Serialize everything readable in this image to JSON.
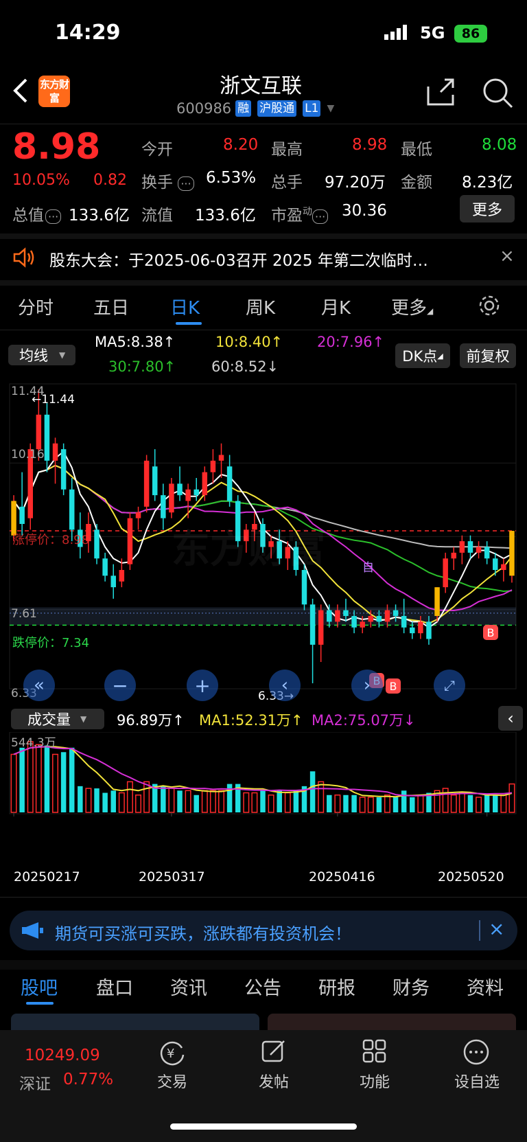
{
  "status_bar": {
    "time": "14:29",
    "network": "5G",
    "battery": "86"
  },
  "header": {
    "logo": "东方财富",
    "title": "浙文互联",
    "code": "600986",
    "tags": [
      "融",
      "沪股通",
      "L1"
    ]
  },
  "quote": {
    "price": "8.98",
    "change_pct": "10.05%",
    "change": "0.82",
    "open_label": "今开",
    "open": "8.20",
    "high_label": "最高",
    "high": "8.98",
    "low_label": "最低",
    "low": "8.08",
    "turnover_label": "换手",
    "turnover": "6.53%",
    "volume_label": "总手",
    "volume": "97.20万",
    "amount_label": "金额",
    "amount": "8.23亿",
    "mcap_label": "总值",
    "mcap": "133.6亿",
    "float_label": "流值",
    "float": "133.6亿",
    "pe_label": "市盈",
    "pe_sup": "动",
    "pe": "30.36",
    "more": "更多"
  },
  "notice": {
    "text": "股东大会：于2025-06-03召开 2025 年第二次临时…"
  },
  "period_tabs": [
    "分时",
    "五日",
    "日K",
    "周K",
    "月K",
    "更多"
  ],
  "period_active": 2,
  "ma_bar": {
    "selector": "均线",
    "ma5": "MA5:8.38↑",
    "ma10": "10:8.40↑",
    "ma20": "20:7.96↑",
    "ma30": "30:7.80↑",
    "ma60": "60:8.52↓",
    "dk": "DK点",
    "adjust": "前复权"
  },
  "kline": {
    "y_top": "11.44",
    "y_high2": "10.16",
    "y_88": "8.88",
    "y_761": "7.61",
    "y_bottom": "6.33",
    "max_label": "←11.44",
    "min_label": "6.33→",
    "limit_up_label": "涨停价：8.98",
    "limit_down_label": "跌停价：7.34",
    "watermark": "东方财富",
    "mark_zi": "自",
    "mark_b": "B",
    "limit_up": 8.98,
    "limit_down": 7.34,
    "ymin": 6.33,
    "ymax": 11.44
  },
  "volume_bar": {
    "selector": "成交量",
    "vol": "96.89万↑",
    "ma1": "MA1:52.31万↑",
    "ma2": "MA2:75.07万↓",
    "y_top": "544.3万"
  },
  "dates": [
    "20250217",
    "20250317",
    "20250416",
    "20250520"
  ],
  "banner": {
    "text": "期货可买涨可买跌，涨跌都有投资机会！"
  },
  "bottom_tabs": [
    "股吧",
    "盘口",
    "资讯",
    "公告",
    "研报",
    "财务",
    "资料"
  ],
  "bottom_active": 0,
  "bottom_nav": {
    "index_value": "10249.09",
    "index_name": "深证",
    "index_pct": "0.77%",
    "items": [
      "交易",
      "发帖",
      "功能",
      "设自选"
    ]
  },
  "colors": {
    "up": "#ff2a2a",
    "down": "#1fdfe0",
    "ma5": "#ffffff",
    "ma10": "#f2e33a",
    "ma20": "#d52fd5",
    "ma30": "#2bbf2b",
    "ma60": "#bdbdbd",
    "accent": "#2d8cf0"
  },
  "chart_data": {
    "type": "candlestick",
    "x_ticks": [
      "20250217",
      "20250317",
      "20250416",
      "20250520"
    ],
    "ylim": [
      6.33,
      11.44
    ],
    "candles": [
      [
        8.9,
        9.6,
        8.8,
        9.5
      ],
      [
        9.4,
        10.0,
        8.9,
        9.1
      ],
      [
        9.2,
        10.5,
        9.0,
        10.4
      ],
      [
        10.4,
        11.44,
        10.2,
        11.0
      ],
      [
        11.0,
        11.2,
        10.0,
        10.2
      ],
      [
        10.2,
        10.6,
        9.8,
        10.5
      ],
      [
        10.4,
        10.5,
        9.6,
        9.7
      ],
      [
        9.7,
        9.9,
        8.8,
        9.0
      ],
      [
        9.0,
        9.3,
        8.5,
        8.7
      ],
      [
        8.8,
        9.3,
        8.6,
        9.1
      ],
      [
        9.0,
        9.1,
        8.4,
        8.5
      ],
      [
        8.5,
        8.6,
        8.1,
        8.2
      ],
      [
        8.2,
        8.4,
        7.8,
        8.0
      ],
      [
        8.1,
        8.5,
        8.0,
        8.3
      ],
      [
        8.4,
        9.3,
        8.3,
        9.2
      ],
      [
        9.2,
        9.4,
        9.0,
        9.3
      ],
      [
        9.4,
        10.3,
        9.3,
        10.2
      ],
      [
        10.1,
        10.4,
        9.5,
        9.6
      ],
      [
        9.6,
        9.8,
        9.0,
        9.2
      ],
      [
        9.3,
        9.9,
        9.2,
        9.8
      ],
      [
        9.8,
        10.1,
        9.5,
        9.6
      ],
      [
        9.5,
        9.8,
        9.2,
        9.7
      ],
      [
        9.7,
        9.9,
        9.5,
        9.6
      ],
      [
        9.6,
        10.1,
        9.5,
        10.0
      ],
      [
        10.0,
        10.4,
        9.8,
        10.2
      ],
      [
        10.2,
        10.5,
        9.9,
        10.3
      ],
      [
        10.1,
        10.3,
        9.4,
        9.5
      ],
      [
        9.5,
        9.6,
        8.7,
        8.8
      ],
      [
        8.8,
        9.1,
        8.6,
        9.0
      ],
      [
        9.0,
        9.3,
        8.8,
        9.1
      ],
      [
        9.1,
        9.2,
        8.6,
        8.7
      ],
      [
        8.7,
        8.9,
        8.5,
        8.8
      ],
      [
        8.8,
        9.0,
        8.4,
        8.5
      ],
      [
        8.5,
        8.8,
        8.3,
        8.7
      ],
      [
        8.7,
        8.8,
        8.2,
        8.3
      ],
      [
        8.3,
        8.4,
        7.6,
        7.7
      ],
      [
        7.7,
        7.8,
        6.33,
        7.0
      ],
      [
        7.0,
        7.7,
        6.7,
        7.6
      ],
      [
        7.6,
        7.7,
        7.3,
        7.4
      ],
      [
        7.4,
        7.7,
        7.3,
        7.6
      ],
      [
        7.6,
        7.8,
        7.4,
        7.5
      ],
      [
        7.5,
        7.6,
        7.2,
        7.3
      ],
      [
        7.3,
        7.5,
        7.2,
        7.4
      ],
      [
        7.4,
        7.6,
        7.3,
        7.5
      ],
      [
        7.5,
        7.6,
        7.3,
        7.4
      ],
      [
        7.4,
        7.7,
        7.3,
        7.6
      ],
      [
        7.6,
        7.7,
        7.4,
        7.5
      ],
      [
        7.5,
        7.8,
        7.2,
        7.3
      ],
      [
        7.3,
        7.4,
        7.1,
        7.2
      ],
      [
        7.2,
        7.5,
        7.1,
        7.4
      ],
      [
        7.4,
        7.5,
        7.0,
        7.1
      ],
      [
        7.5,
        8.0,
        7.4,
        8.0
      ],
      [
        8.0,
        8.6,
        7.9,
        8.5
      ],
      [
        8.5,
        8.7,
        8.3,
        8.6
      ],
      [
        8.6,
        8.9,
        8.4,
        8.8
      ],
      [
        8.8,
        8.9,
        8.5,
        8.6
      ],
      [
        8.6,
        8.8,
        8.5,
        8.7
      ],
      [
        8.7,
        8.8,
        8.4,
        8.5
      ],
      [
        8.5,
        8.6,
        8.2,
        8.3
      ],
      [
        8.3,
        8.5,
        8.1,
        8.4
      ],
      [
        8.2,
        8.98,
        8.08,
        8.98
      ]
    ],
    "volume_max": "544.3万"
  }
}
